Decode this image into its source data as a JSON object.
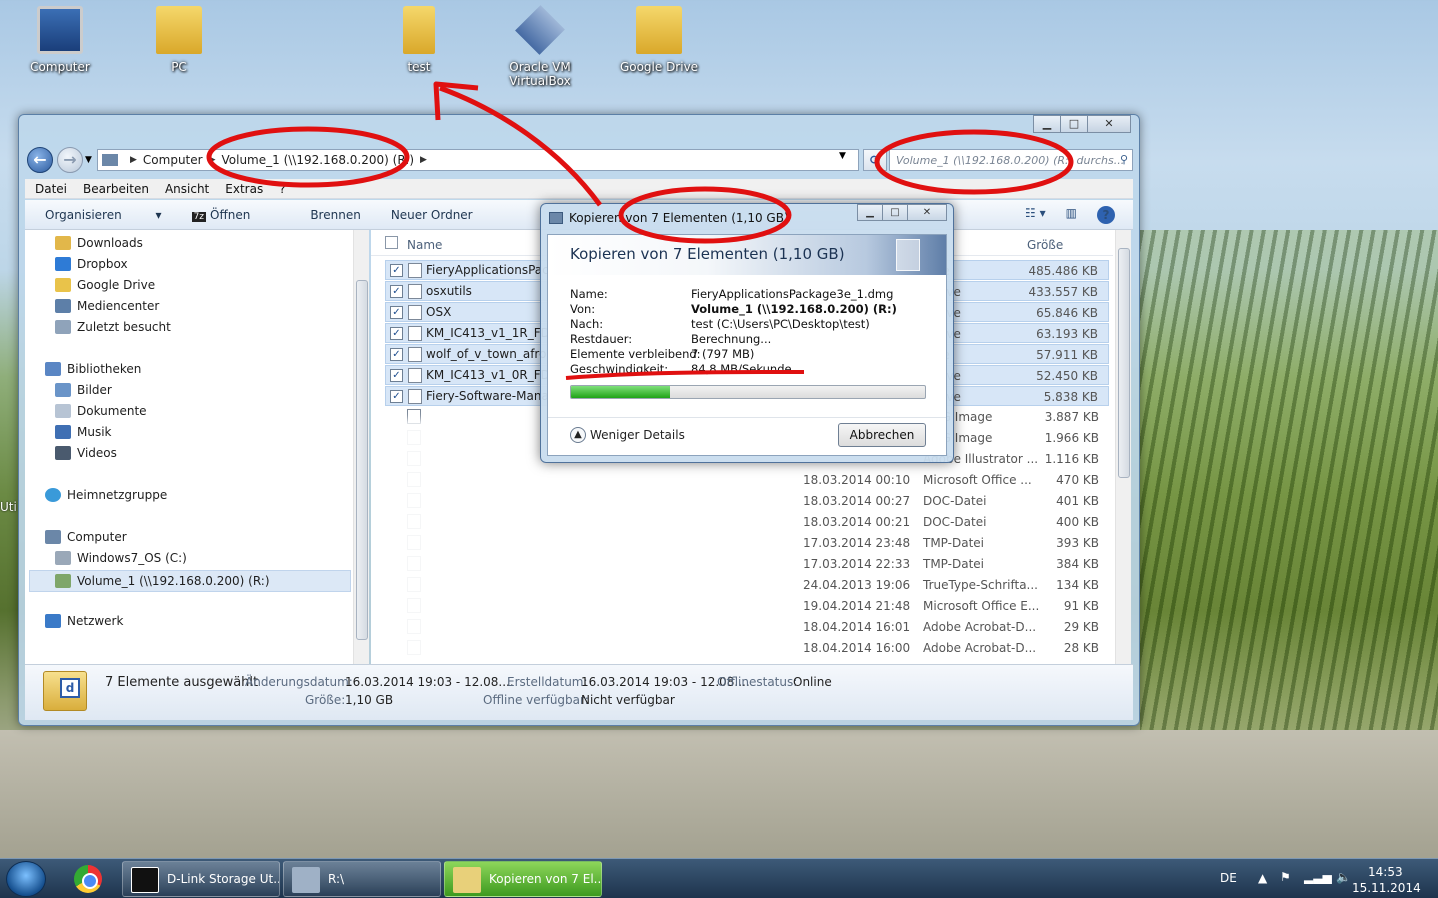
{
  "desktop": {
    "icons": [
      {
        "label": "Computer"
      },
      {
        "label": "PC"
      },
      {
        "label": "test"
      },
      {
        "label": "Oracle VM VirtualBox"
      },
      {
        "label": "Google Drive"
      }
    ],
    "partial_label": "Uti"
  },
  "explorer": {
    "breadcrumb": {
      "root": "Computer",
      "current": "Volume_1 (\\\\192.168.0.200) (R:)"
    },
    "search_placeholder": "Volume_1 (\\\\192.168.0.200) (R:) durchs...",
    "menu": [
      "Datei",
      "Bearbeiten",
      "Ansicht",
      "Extras",
      "?"
    ],
    "toolbar": {
      "organize": "Organisieren",
      "open": "Öffnen",
      "open_badge": "7z",
      "burn": "Brennen",
      "new_folder": "Neuer Ordner"
    },
    "nav": {
      "favorites": [
        "Downloads",
        "Dropbox",
        "Google Drive",
        "Mediencenter",
        "Zuletzt besucht"
      ],
      "libraries": "Bibliotheken",
      "library_items": [
        "Bilder",
        "Dokumente",
        "Musik",
        "Videos"
      ],
      "homegroup": "Heimnetzgruppe",
      "computer": "Computer",
      "computer_items": [
        "Windows7_OS (C:)",
        "Volume_1 (\\\\192.168.0.200) (R:)"
      ],
      "network": "Netzwerk"
    },
    "columns": {
      "name": "Name",
      "size": "Größe"
    },
    "files": [
      {
        "name": "FieryApplicationsPack",
        "date": "",
        "type": "...ve",
        "size": "485.486 KB",
        "checked": true
      },
      {
        "name": "osxutils",
        "date": "",
        "type": "...hive",
        "size": "433.557 KB",
        "checked": true
      },
      {
        "name": "OSX",
        "date": "",
        "type": "...hive",
        "size": "65.846 KB",
        "checked": true
      },
      {
        "name": "KM_IC413_v1_1R_FD4",
        "date": "",
        "type": "...hive",
        "size": "63.193 KB",
        "checked": true
      },
      {
        "name": "wolf_of_v_town_afrod",
        "date": "",
        "type": "...ve",
        "size": "57.911 KB",
        "checked": true
      },
      {
        "name": "KM_IC413_v1_0R_FD4",
        "date": "",
        "type": "...hive",
        "size": "52.450 KB",
        "checked": true
      },
      {
        "name": "Fiery-Software-Manag",
        "date": "",
        "type": "...hive",
        "size": "5.838 KB",
        "checked": true
      },
      {
        "name": "",
        "date": "",
        "type": "...PG Image",
        "size": "3.887 KB",
        "checked": false
      },
      {
        "name": "",
        "date": "",
        "type": "...PG Image",
        "size": "1.966 KB",
        "checked": false
      },
      {
        "name": "",
        "date": "",
        "type": "Adobe Illustrator ...",
        "size": "1.116 KB",
        "checked": false
      },
      {
        "name": "",
        "date": "18.03.2014 00:10",
        "type": "Microsoft Office ...",
        "size": "470 KB",
        "checked": false
      },
      {
        "name": "",
        "date": "18.03.2014 00:27",
        "type": "DOC-Datei",
        "size": "401 KB",
        "checked": false
      },
      {
        "name": "",
        "date": "18.03.2014 00:21",
        "type": "DOC-Datei",
        "size": "400 KB",
        "checked": false
      },
      {
        "name": "",
        "date": "17.03.2014 23:48",
        "type": "TMP-Datei",
        "size": "393 KB",
        "checked": false
      },
      {
        "name": "",
        "date": "17.03.2014 22:33",
        "type": "TMP-Datei",
        "size": "384 KB",
        "checked": false
      },
      {
        "name": "",
        "date": "24.04.2013 19:06",
        "type": "TrueType-Schrifta...",
        "size": "134 KB",
        "checked": false
      },
      {
        "name": "",
        "date": "19.04.2014 21:48",
        "type": "Microsoft Office E...",
        "size": "91 KB",
        "checked": false
      },
      {
        "name": "",
        "date": "18.04.2014 16:01",
        "type": "Adobe Acrobat-D...",
        "size": "29 KB",
        "checked": false
      },
      {
        "name": "",
        "date": "18.04.2014 16:00",
        "type": "Adobe Acrobat-D...",
        "size": "28 KB",
        "checked": false
      }
    ],
    "details": {
      "selected": "7 Elemente ausgewählt",
      "mod_label": "Änderungsdatum:",
      "mod_value": "16.03.2014 19:03 - 12.08....",
      "created_label": "Erstelldatum:",
      "created_value": "16.03.2014 19:03 - 12.08....",
      "offline_label": "Offlinestatus:",
      "offline_value": "Online",
      "size_label": "Größe:",
      "size_value": "1,10 GB",
      "avail_label": "Offline verfügbar:",
      "avail_value": "Nicht verfügbar"
    }
  },
  "copy_dialog": {
    "title": "Kopieren von 7 Elementen (1,10 GB)",
    "heading": "Kopieren von 7 Elementen (1,10 GB)",
    "fields": [
      {
        "label": "Name:",
        "value": "FieryApplicationsPackage3e_1.dmg"
      },
      {
        "label": "Von:",
        "value": "Volume_1 (\\\\192.168.0.200) (R:)"
      },
      {
        "label": "Nach:",
        "value": "test (C:\\Users\\PC\\Desktop\\test)"
      },
      {
        "label": "Restdauer:",
        "value": "Berechnung..."
      },
      {
        "label": "Elemente verbleibend:",
        "value": "7 (797 MB)"
      },
      {
        "label": "Geschwindigkeit:",
        "value": "84,8 MB/Sekunde"
      }
    ],
    "progress": 0.28,
    "less_details": "Weniger Details",
    "cancel": "Abbrechen"
  },
  "taskbar": {
    "apps": [
      {
        "label": "D-Link Storage Ut..."
      },
      {
        "label": "R:\\"
      },
      {
        "label": "Kopieren von 7 El..."
      }
    ],
    "lang": "DE",
    "time": "14:53",
    "date": "15.11.2014"
  },
  "colors": {
    "annotation": "#e01010",
    "progress": "#1fa318"
  }
}
